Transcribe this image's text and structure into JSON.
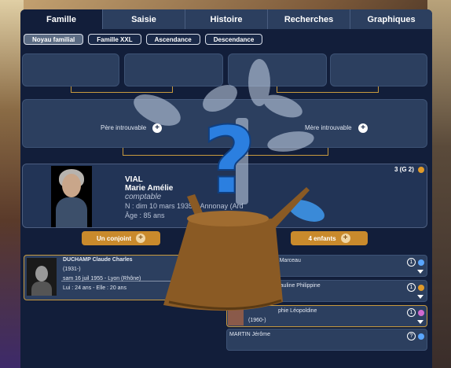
{
  "tabs": [
    {
      "label": "Famille"
    },
    {
      "label": "Saisie"
    },
    {
      "label": "Histoire"
    },
    {
      "label": "Recherches"
    },
    {
      "label": "Graphiques"
    }
  ],
  "subtabs": [
    {
      "label": "Noyau familial"
    },
    {
      "label": "Famille XXL"
    },
    {
      "label": "Ascendance"
    },
    {
      "label": "Descendance"
    }
  ],
  "parents": {
    "father_label": "Père introuvable",
    "mother_label": "Mère introuvable",
    "plus": "+"
  },
  "person": {
    "surname": "VIAL",
    "given": "Marie Amélie",
    "job": "comptable",
    "birth": "N : dim 10 mars 1935 – Annonay (Ard",
    "age": "Âge : 85 ans",
    "count": "3 (G 2)"
  },
  "buttons": {
    "spouse": "Un conjoint",
    "children": "4 enfants",
    "plus": "+"
  },
  "spouse": {
    "name": "DUCHAMP Claude Charles",
    "years": "(1931-)",
    "marriage": "sam 16 juil 1955 - Lyon (Rhône)",
    "ages": "Lui : 24 ans - Elle : 20 ans"
  },
  "children": [
    {
      "name": "MP Jérôme Marceau",
      "num": "1"
    },
    {
      "name": "Pauline Philippine",
      "num": "1"
    },
    {
      "name": "phie Léopoldine",
      "years": "(1960-)",
      "num": "1"
    },
    {
      "name": "MARTIN Jérôme",
      "num": "?"
    }
  ],
  "overlay": {
    "question_mark": "?"
  },
  "colors": {
    "panel": "#121e3a",
    "card": "#2c3f5f",
    "accent": "#c98a2c",
    "connector": "#c89a3e",
    "male_icon": "#5aa6ff",
    "female_icon": "#e09a2a",
    "pink_icon": "#d06ad0"
  }
}
